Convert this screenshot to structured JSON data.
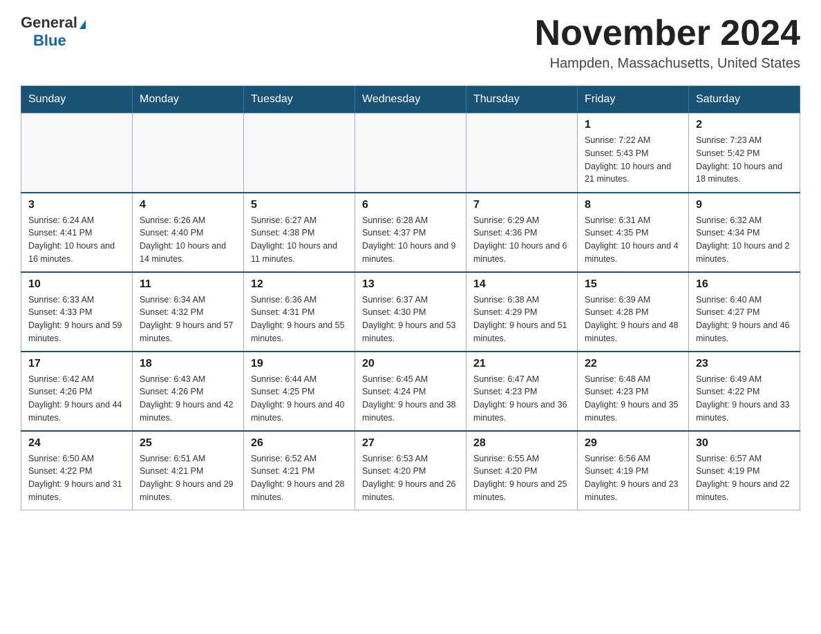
{
  "logo": {
    "general": "General",
    "blue": "Blue"
  },
  "title": "November 2024",
  "location": "Hampden, Massachusetts, United States",
  "weekdays": [
    "Sunday",
    "Monday",
    "Tuesday",
    "Wednesday",
    "Thursday",
    "Friday",
    "Saturday"
  ],
  "weeks": [
    [
      {
        "day": "",
        "info": ""
      },
      {
        "day": "",
        "info": ""
      },
      {
        "day": "",
        "info": ""
      },
      {
        "day": "",
        "info": ""
      },
      {
        "day": "",
        "info": ""
      },
      {
        "day": "1",
        "info": "Sunrise: 7:22 AM\nSunset: 5:43 PM\nDaylight: 10 hours and 21 minutes."
      },
      {
        "day": "2",
        "info": "Sunrise: 7:23 AM\nSunset: 5:42 PM\nDaylight: 10 hours and 18 minutes."
      }
    ],
    [
      {
        "day": "3",
        "info": "Sunrise: 6:24 AM\nSunset: 4:41 PM\nDaylight: 10 hours and 16 minutes."
      },
      {
        "day": "4",
        "info": "Sunrise: 6:26 AM\nSunset: 4:40 PM\nDaylight: 10 hours and 14 minutes."
      },
      {
        "day": "5",
        "info": "Sunrise: 6:27 AM\nSunset: 4:38 PM\nDaylight: 10 hours and 11 minutes."
      },
      {
        "day": "6",
        "info": "Sunrise: 6:28 AM\nSunset: 4:37 PM\nDaylight: 10 hours and 9 minutes."
      },
      {
        "day": "7",
        "info": "Sunrise: 6:29 AM\nSunset: 4:36 PM\nDaylight: 10 hours and 6 minutes."
      },
      {
        "day": "8",
        "info": "Sunrise: 6:31 AM\nSunset: 4:35 PM\nDaylight: 10 hours and 4 minutes."
      },
      {
        "day": "9",
        "info": "Sunrise: 6:32 AM\nSunset: 4:34 PM\nDaylight: 10 hours and 2 minutes."
      }
    ],
    [
      {
        "day": "10",
        "info": "Sunrise: 6:33 AM\nSunset: 4:33 PM\nDaylight: 9 hours and 59 minutes."
      },
      {
        "day": "11",
        "info": "Sunrise: 6:34 AM\nSunset: 4:32 PM\nDaylight: 9 hours and 57 minutes."
      },
      {
        "day": "12",
        "info": "Sunrise: 6:36 AM\nSunset: 4:31 PM\nDaylight: 9 hours and 55 minutes."
      },
      {
        "day": "13",
        "info": "Sunrise: 6:37 AM\nSunset: 4:30 PM\nDaylight: 9 hours and 53 minutes."
      },
      {
        "day": "14",
        "info": "Sunrise: 6:38 AM\nSunset: 4:29 PM\nDaylight: 9 hours and 51 minutes."
      },
      {
        "day": "15",
        "info": "Sunrise: 6:39 AM\nSunset: 4:28 PM\nDaylight: 9 hours and 48 minutes."
      },
      {
        "day": "16",
        "info": "Sunrise: 6:40 AM\nSunset: 4:27 PM\nDaylight: 9 hours and 46 minutes."
      }
    ],
    [
      {
        "day": "17",
        "info": "Sunrise: 6:42 AM\nSunset: 4:26 PM\nDaylight: 9 hours and 44 minutes."
      },
      {
        "day": "18",
        "info": "Sunrise: 6:43 AM\nSunset: 4:26 PM\nDaylight: 9 hours and 42 minutes."
      },
      {
        "day": "19",
        "info": "Sunrise: 6:44 AM\nSunset: 4:25 PM\nDaylight: 9 hours and 40 minutes."
      },
      {
        "day": "20",
        "info": "Sunrise: 6:45 AM\nSunset: 4:24 PM\nDaylight: 9 hours and 38 minutes."
      },
      {
        "day": "21",
        "info": "Sunrise: 6:47 AM\nSunset: 4:23 PM\nDaylight: 9 hours and 36 minutes."
      },
      {
        "day": "22",
        "info": "Sunrise: 6:48 AM\nSunset: 4:23 PM\nDaylight: 9 hours and 35 minutes."
      },
      {
        "day": "23",
        "info": "Sunrise: 6:49 AM\nSunset: 4:22 PM\nDaylight: 9 hours and 33 minutes."
      }
    ],
    [
      {
        "day": "24",
        "info": "Sunrise: 6:50 AM\nSunset: 4:22 PM\nDaylight: 9 hours and 31 minutes."
      },
      {
        "day": "25",
        "info": "Sunrise: 6:51 AM\nSunset: 4:21 PM\nDaylight: 9 hours and 29 minutes."
      },
      {
        "day": "26",
        "info": "Sunrise: 6:52 AM\nSunset: 4:21 PM\nDaylight: 9 hours and 28 minutes."
      },
      {
        "day": "27",
        "info": "Sunrise: 6:53 AM\nSunset: 4:20 PM\nDaylight: 9 hours and 26 minutes."
      },
      {
        "day": "28",
        "info": "Sunrise: 6:55 AM\nSunset: 4:20 PM\nDaylight: 9 hours and 25 minutes."
      },
      {
        "day": "29",
        "info": "Sunrise: 6:56 AM\nSunset: 4:19 PM\nDaylight: 9 hours and 23 minutes."
      },
      {
        "day": "30",
        "info": "Sunrise: 6:57 AM\nSunset: 4:19 PM\nDaylight: 9 hours and 22 minutes."
      }
    ]
  ]
}
